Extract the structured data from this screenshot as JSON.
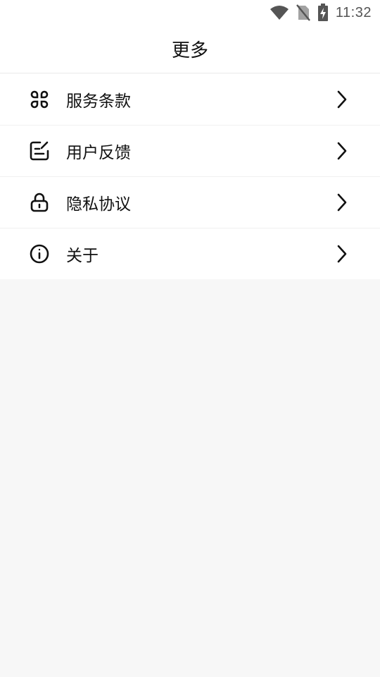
{
  "status_bar": {
    "time": "11:32",
    "icons": [
      "wifi-icon",
      "no-sim-icon",
      "battery-charging-icon"
    ]
  },
  "header": {
    "title": "更多"
  },
  "menu": {
    "items": [
      {
        "label": "服务条款",
        "icon": "command-icon"
      },
      {
        "label": "用户反馈",
        "icon": "feedback-edit-icon"
      },
      {
        "label": "隐私协议",
        "icon": "lock-icon"
      },
      {
        "label": "关于",
        "icon": "info-icon"
      }
    ]
  }
}
